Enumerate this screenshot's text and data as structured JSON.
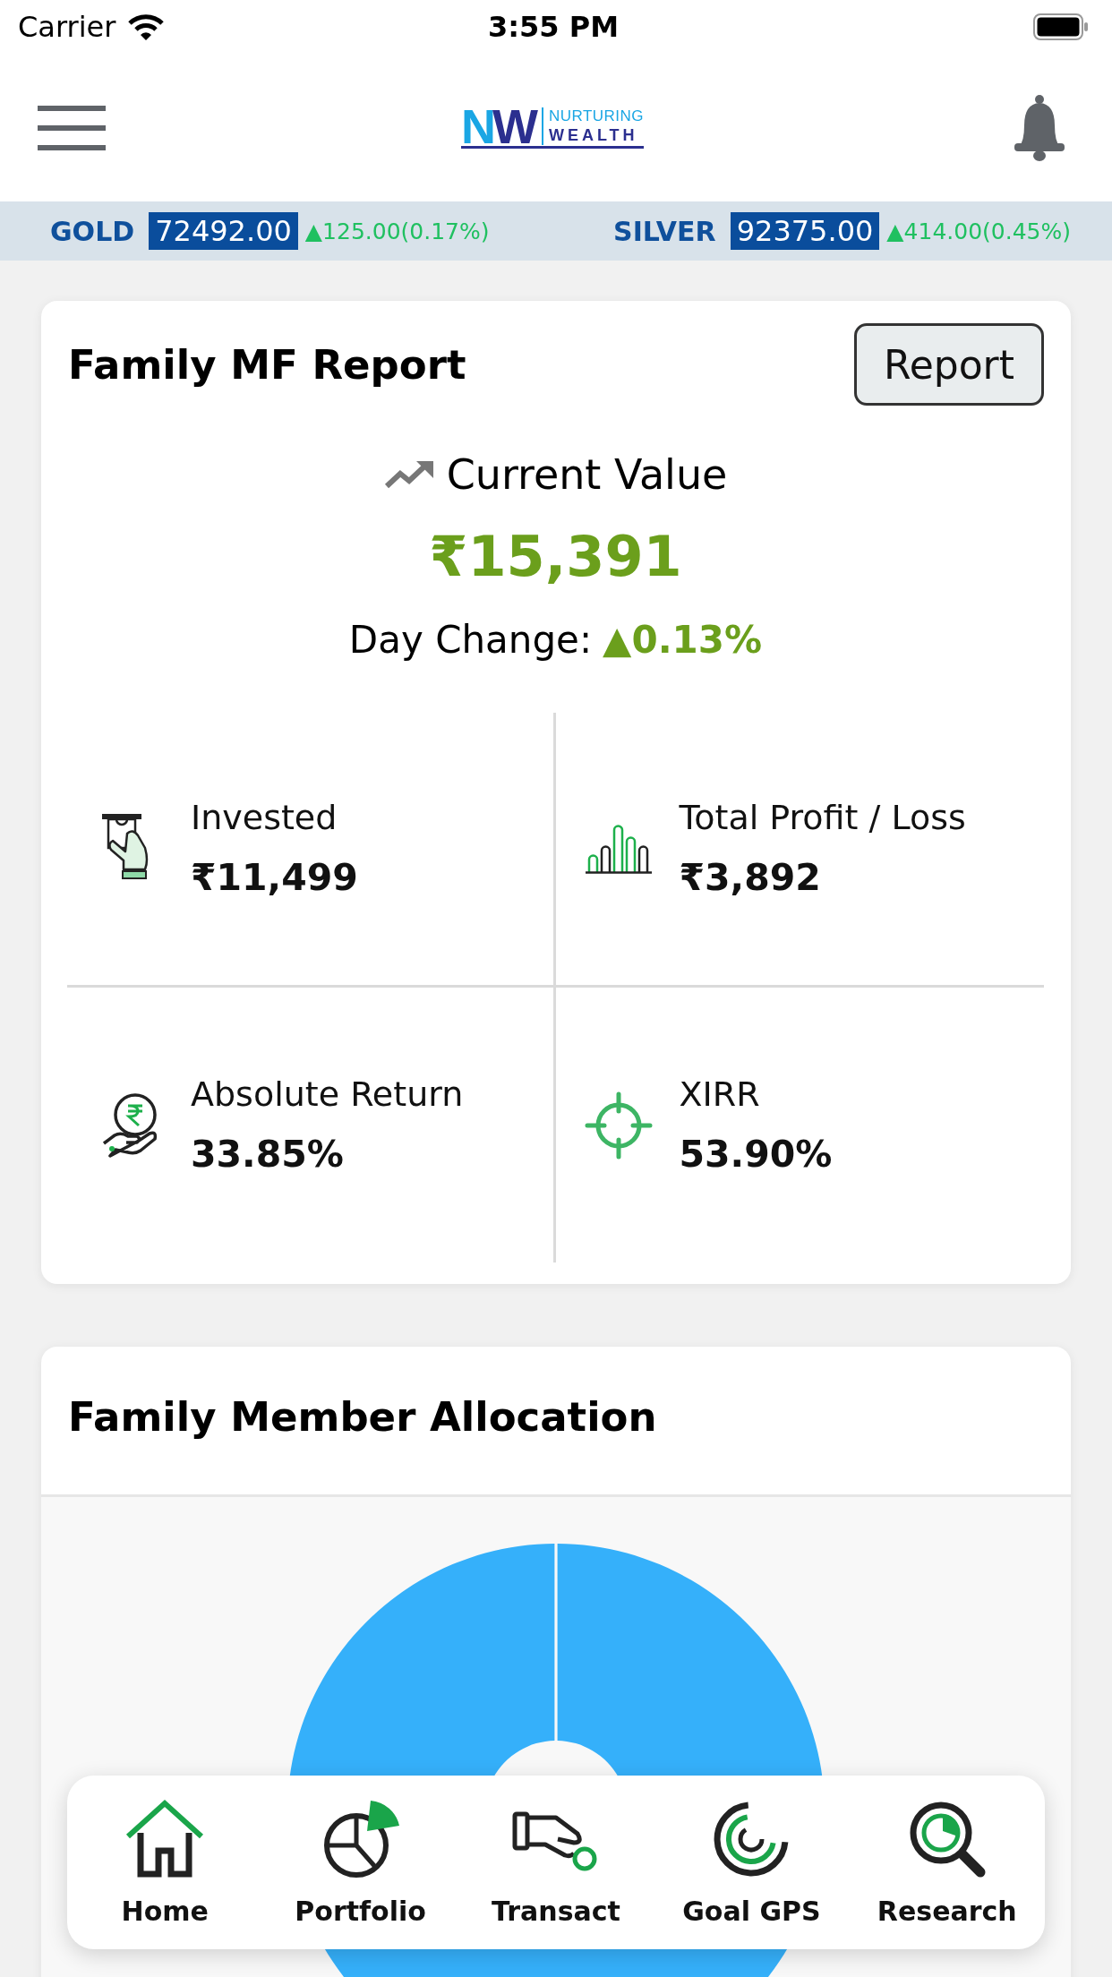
{
  "status_bar": {
    "carrier": "Carrier",
    "time": "3:55 PM"
  },
  "header": {
    "logo": {
      "mark": "NW",
      "tagline": "NURTURING",
      "wordmark": "WEALTH"
    }
  },
  "ticker": [
    {
      "name": "GOLD",
      "price": "72492.00",
      "change": "▲125.00(0.17%)"
    },
    {
      "name": "SILVER",
      "price": "92375.00",
      "change": "▲414.00(0.45%)"
    }
  ],
  "mf_report": {
    "title": "Family MF Report",
    "button": "Report",
    "current_value_label": "Current Value",
    "current_value": "₹15,391",
    "day_change_label": "Day Change:",
    "day_change": "▲0.13%",
    "metrics": [
      {
        "kind": "invested",
        "label": "Invested",
        "value": "₹11,499"
      },
      {
        "kind": "profit",
        "label": "Total Profit / Loss",
        "value": "₹3,892"
      },
      {
        "kind": "return",
        "label": "Absolute Return",
        "value": "33.85%"
      },
      {
        "kind": "xirr",
        "label": "XIRR",
        "value": "53.90%"
      }
    ]
  },
  "allocation": {
    "title": "Family Member Allocation"
  },
  "bottom_nav": [
    {
      "kind": "home",
      "label": "Home"
    },
    {
      "kind": "portfolio",
      "label": "Portfolio"
    },
    {
      "kind": "transact",
      "label": "Transact"
    },
    {
      "kind": "goal",
      "label": "Goal GPS"
    },
    {
      "kind": "research",
      "label": "Research"
    }
  ]
}
